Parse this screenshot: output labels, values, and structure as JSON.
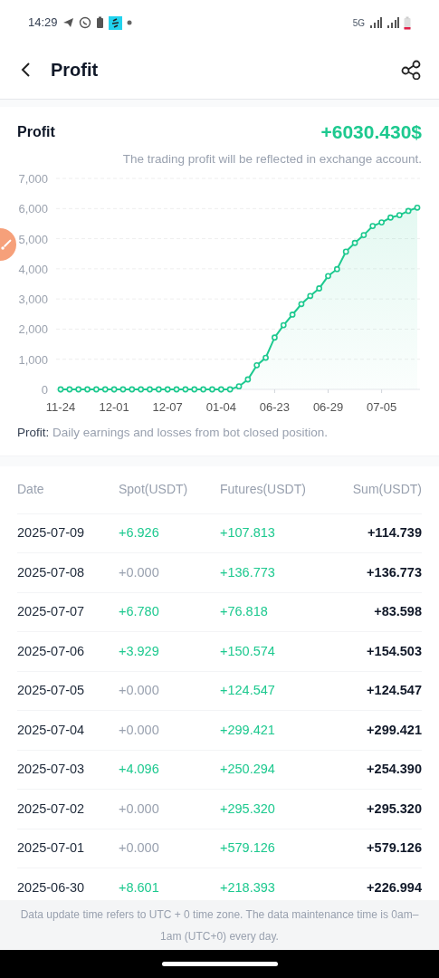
{
  "status_bar": {
    "time": "14:29",
    "network": "5G"
  },
  "header": {
    "title": "Profit"
  },
  "summary": {
    "label": "Profit",
    "value": "+6030.430$",
    "note": "The trading profit will be reflected in exchange account."
  },
  "chart_data": {
    "type": "area",
    "grid": true,
    "categories": [
      "11-24",
      null,
      null,
      null,
      null,
      null,
      "12-01",
      null,
      null,
      null,
      null,
      null,
      "12-07",
      null,
      null,
      null,
      null,
      null,
      "01-04",
      null,
      null,
      null,
      null,
      null,
      "06-23",
      null,
      null,
      null,
      null,
      null,
      "06-29",
      null,
      null,
      null,
      null,
      null,
      "07-05",
      null,
      null,
      null,
      null
    ],
    "series": [
      {
        "color": "#1dc98f",
        "values": [
          0,
          0,
          0,
          0,
          0,
          0,
          0,
          0,
          0,
          0,
          0,
          0,
          0,
          0,
          0,
          0,
          0,
          0,
          0,
          0,
          100,
          330,
          800,
          1050,
          1720,
          2130,
          2480,
          2830,
          3100,
          3350,
          3760,
          3990,
          4570,
          4860,
          5120,
          5420,
          5540,
          5700,
          5780,
          5920,
          6030
        ]
      }
    ],
    "ylim": [
      0,
      7000
    ],
    "yticks": [
      {
        "value": 0,
        "label": "0"
      },
      {
        "value": 1000,
        "label": "1,000"
      },
      {
        "value": 2000,
        "label": "2,000"
      },
      {
        "value": 3000,
        "label": "3,000"
      },
      {
        "value": 4000,
        "label": "4,000"
      },
      {
        "value": 5000,
        "label": "5,000"
      },
      {
        "value": 6000,
        "label": "6,000"
      },
      {
        "value": 7000,
        "label": "7,000"
      }
    ]
  },
  "legend": "**Profit:** Daily earnings and losses from bot closed position.",
  "table": {
    "columns": [
      "Date",
      "Spot(USDT)",
      "Futures(USDT)",
      "Sum(USDT)"
    ],
    "rows": [
      {
        "date": "2025-07-09",
        "spot": "+6.926",
        "spot_positive": true,
        "futures": "+107.813",
        "sum": "+114.739"
      },
      {
        "date": "2025-07-08",
        "spot": "+0.000",
        "spot_positive": false,
        "futures": "+136.773",
        "sum": "+136.773"
      },
      {
        "date": "2025-07-07",
        "spot": "+6.780",
        "spot_positive": true,
        "futures": "+76.818",
        "sum": "+83.598"
      },
      {
        "date": "2025-07-06",
        "spot": "+3.929",
        "spot_positive": true,
        "futures": "+150.574",
        "sum": "+154.503"
      },
      {
        "date": "2025-07-05",
        "spot": "+0.000",
        "spot_positive": false,
        "futures": "+124.547",
        "sum": "+124.547"
      },
      {
        "date": "2025-07-04",
        "spot": "+0.000",
        "spot_positive": false,
        "futures": "+299.421",
        "sum": "+299.421"
      },
      {
        "date": "2025-07-03",
        "spot": "+4.096",
        "spot_positive": true,
        "futures": "+250.294",
        "sum": "+254.390"
      },
      {
        "date": "2025-07-02",
        "spot": "+0.000",
        "spot_positive": false,
        "futures": "+295.320",
        "sum": "+295.320"
      },
      {
        "date": "2025-07-01",
        "spot": "+0.000",
        "spot_positive": false,
        "futures": "+579.126",
        "sum": "+579.126"
      },
      {
        "date": "2025-06-30",
        "spot": "+8.601",
        "spot_positive": true,
        "futures": "+218.393",
        "sum": "+226.994"
      }
    ]
  },
  "footer": "Data update time refers to UTC + 0 time zone. The data maintenance time is 0am–1am (UTC+0) every day."
}
